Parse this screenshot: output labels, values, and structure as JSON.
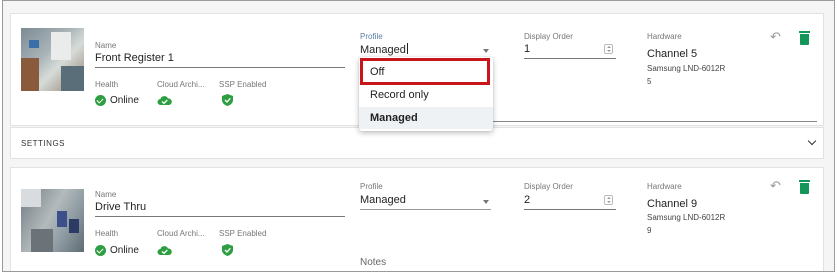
{
  "cameras": [
    {
      "name_label": "Name",
      "name": "Front Register 1",
      "health_label": "Health",
      "health_value": "Online",
      "cloud_label": "Cloud Archi...",
      "ssp_label": "SSP Enabled",
      "profile_label": "Profile",
      "profile_value": "Managed",
      "display_order_label": "Display Order",
      "display_order": "1",
      "hardware_label": "Hardware",
      "channel": "Channel 5",
      "model": "Samsung LND-6012R",
      "model_index": "5"
    },
    {
      "name_label": "Name",
      "name": "Drive Thru",
      "health_label": "Health",
      "health_value": "Online",
      "cloud_label": "Cloud Archi...",
      "ssp_label": "SSP Enabled",
      "profile_label": "Profile",
      "profile_value": "Managed",
      "display_order_label": "Display Order",
      "display_order": "2",
      "hardware_label": "Hardware",
      "channel": "Channel 9",
      "model": "Samsung LND-6012R",
      "model_index": "9",
      "notes_label": "Notes"
    }
  ],
  "settings_label": "SETTINGS",
  "profile_dropdown": {
    "options": [
      "Off",
      "Record only",
      "Managed"
    ],
    "selected": "Managed",
    "highlighted": "Off"
  },
  "colors": {
    "success": "#2e9e42",
    "delete": "#14965a",
    "highlight": "#c8151b"
  },
  "icons": {
    "undo": "undo-icon",
    "delete": "trash-icon",
    "online": "check-circle-icon",
    "cloud": "cloud-check-icon",
    "ssp": "shield-check-icon",
    "expand": "chevron-down-icon"
  }
}
